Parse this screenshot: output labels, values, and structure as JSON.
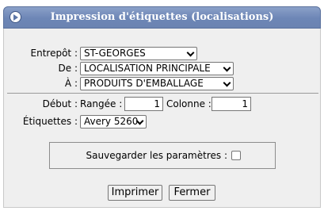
{
  "dialog": {
    "title": "Impression d'étiquettes (localisations)"
  },
  "form": {
    "entrepot_label": "Entrepôt :",
    "entrepot_value": "ST-GEORGES",
    "de_label": "De :",
    "de_value": "LOCALISATION PRINCIPALE",
    "a_label": "À :",
    "a_value": "PRODUITS D'EMBALLAGE",
    "debut_label": "Début :",
    "rangee_label": "Rangée :",
    "rangee_value": "1",
    "colonne_label": "Colonne :",
    "colonne_value": "1",
    "etiquettes_label": "Étiquettes :",
    "etiquettes_value": "Avery 5260",
    "save_label": "Sauvegarder les paramètres :"
  },
  "buttons": {
    "print": "Imprimer",
    "close": "Fermer"
  },
  "icons": {
    "title": "arrow-right-circle-icon",
    "dropdown": "chevron-down-icon"
  }
}
